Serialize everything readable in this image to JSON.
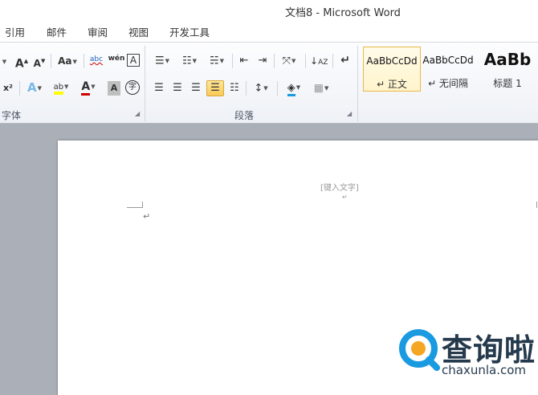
{
  "window": {
    "title": "文档8 - Microsoft Word"
  },
  "tabs": [
    "引用",
    "邮件",
    "审阅",
    "视图",
    "开发工具"
  ],
  "ribbon": {
    "font_group": {
      "label": "字体",
      "row1": [
        "A",
        "A",
        "Aa",
        "abc",
        "wén",
        "A"
      ],
      "row2": [
        "x²",
        "A",
        "ab",
        "A",
        "A",
        "字"
      ]
    },
    "paragraph_group": {
      "label": "段落"
    },
    "styles": [
      {
        "sample": "AaBbCcDd",
        "name": "↵ 正文",
        "active": true
      },
      {
        "sample": "AaBbCcDd",
        "name": "↵ 无间隔",
        "active": false
      },
      {
        "sample": "AaBb",
        "name": "标题 1",
        "active": false
      }
    ]
  },
  "document": {
    "header_placeholder": "[键入文字]",
    "paragraph_mark": "↵"
  },
  "watermark": {
    "brand": "查询啦",
    "url": "chaxunla.com"
  },
  "colors": {
    "highlight": "#ffff00",
    "font_color": "#d00000",
    "accent_blue": "#1a9ae0",
    "watermark_dark": "#263a4d"
  }
}
